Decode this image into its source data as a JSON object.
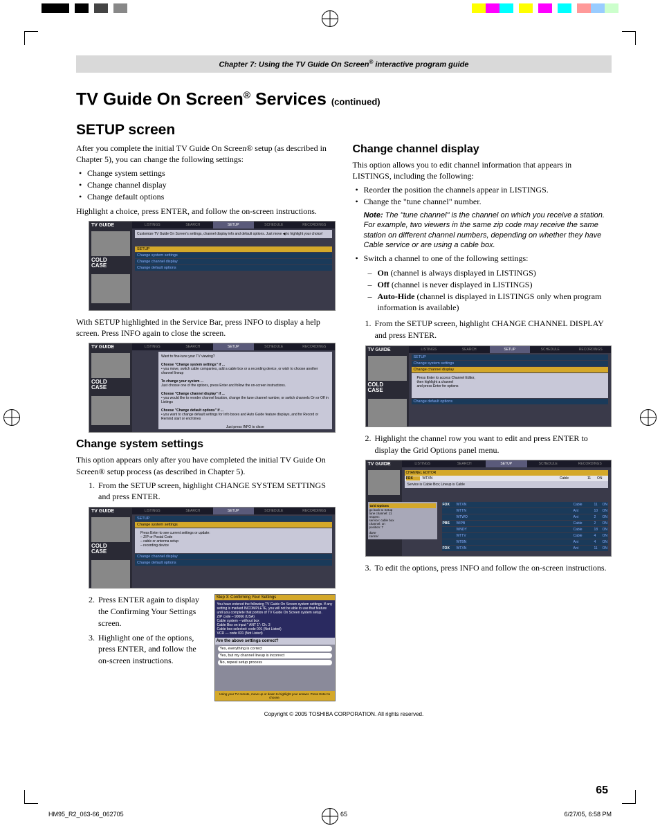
{
  "header": {
    "chapter_label": "Chapter 7: Using the TV Guide On Screen",
    "reg": "®",
    "chapter_suffix": " interactive program guide"
  },
  "title": {
    "main": "TV Guide On Screen",
    "reg": "®",
    "svc": " Services ",
    "cont": "(continued)"
  },
  "setup": {
    "heading": "SETUP screen",
    "intro": "After you complete the initial TV Guide On Screen® setup (as described in Chapter 5), you can change the following settings:",
    "bullets": [
      "Change system settings",
      "Change channel display",
      "Change default options"
    ],
    "instr": "Highlight a choice, press ENTER, and follow the on-screen instructions.",
    "after": "With SETUP highlighted in the Service Bar, press INFO to display a help screen. Press INFO again to close the screen."
  },
  "css": {
    "heading": "Change system settings",
    "intro": "This option appears only after you have completed the initial TV Guide On Screen® setup process (as described in Chapter 5).",
    "step1": "From the SETUP screen, highlight CHANGE SYSTEM SETTINGS and press ENTER.",
    "step2": "Press ENTER again to display the Confirming Your Settings screen.",
    "step3": "Highlight one of the options, press ENTER, and follow the on-screen instructions."
  },
  "ccd": {
    "heading": "Change channel display",
    "intro": "This option allows you to edit channel information that appears in LISTINGS, including the following:",
    "b1": "Reorder the position the channels appear in LISTINGS.",
    "b2": "Change the \"tune channel\" number.",
    "note_label": "Note:",
    "note": " The \"tune channel\" is the channel on which you receive a station. For example, two viewers in the same zip code may receive the same station on different channel numbers, depending on whether they have Cable service or are using a cable box.",
    "b3": "Switch a channel to one of the following settings:",
    "d1_b": "On",
    "d1": " (channel is always displayed in LISTINGS)",
    "d2_b": "Off",
    "d2": " (channel is never displayed in LISTINGS)",
    "d3_b": "Auto-Hide",
    "d3": " (channel is displayed in LISTINGS only when program information is available)",
    "step1": "From the SETUP screen, highlight CHANGE CHANNEL DISPLAY and press ENTER.",
    "step2": "Highlight the channel row you want to edit and press ENTER to display the Grid Options panel menu.",
    "step3": "To edit the options, press INFO and follow the on-screen instructions."
  },
  "ss": {
    "topbar": [
      "LISTINGS",
      "SEARCH",
      "SETUP",
      "SCHEDULE",
      "RECORDINGS"
    ],
    "logo": "TV GUIDE",
    "cold": "COLD\nCASE",
    "tip": "Customize TV Guide On Screen's settings, channel display info and default options. Just move ◀ to highlight your choice!",
    "menu": [
      "SETUP",
      "Change system settings",
      "Change channel display",
      "Change default options"
    ],
    "info_title": "Want to fine-tune your TV viewing?",
    "info_1": "Choose \"Change system settings\" if ...",
    "info_1a": "• you move, switch cable companies, add a cable box or a recording device, or wish to choose another channel lineup",
    "info_2": "To change your system ...",
    "info_2a": "Just choose one of the options, press Enter and follow the on-screen instructions.",
    "info_3": "Choose \"Change channel display\" if ...",
    "info_3a": "• you would like to reorder channel location, change the tune channel number, or switch channels On or Off in Listings",
    "info_4": "Choose \"Change default options\" if ...",
    "info_4a": "• you want to change default settings for Info boxes and Auto Guide feature displays, and for Record or Remind start or end times",
    "info_close": "Just press INFO to close",
    "setup_heading": "SETUP",
    "css_item": "Change system settings",
    "css_detail": "Press Enter to see current settings or update:\n– ZIP or Postal Code\n– cable or antenna setup\n– recording device",
    "ccd_item": "Change channel display",
    "cdo_item": "Change default options",
    "ccd_detail": "Press Enter to access Channel Editor,\nthen highlight a channel\nand press Enter for options",
    "confirm_title": "Step 3: Confirming Your Settings",
    "confirm_body": "You have entered the following TV Guide On Screen system settings. If any setting is marked INCOMPLETE, you will not be able to use that feature until you complete that portion of TV Guide On Screen system setup.\n   ZIP code – 90066 (USA)\n   Cable system – without box\n   Cable Box on input \" ANT 1\": Ch. 3\n   Cable box selected: code 001 (Not Listed)\n   VCR — code 031 (Not Listed)",
    "confirm_prompt": "Are the above settings correct?",
    "confirm_c1": "Yes, everything is correct",
    "confirm_c2": "Yes, but my channel lineup is incorrect",
    "confirm_c3": "No, repeat setup process",
    "confirm_footer": "Using your TV remote, move up or down to highlight your answer. Press Enter to choose.",
    "editor_title": "CHANNEL EDITOR",
    "editor_service": "Service is Cable Box; Lineup is Cable",
    "grid_opt": "Grid Options",
    "go_back": "go back to Setup",
    "rows": [
      {
        "call": "FOX",
        "st": "WTXN",
        "svc": "Cable",
        "ch": "11",
        "on": "ON"
      },
      {
        "call": "",
        "st": "WTTN",
        "svc": "Ant",
        "ch": "10",
        "on": "ON"
      },
      {
        "call": "",
        "st": "WTWO",
        "svc": "Ant",
        "ch": "2",
        "on": "ON"
      },
      {
        "call": "PBS",
        "st": "WIPB",
        "svc": "Cable",
        "ch": "2",
        "on": "ON"
      },
      {
        "call": "",
        "st": "WNDY",
        "svc": "Cable",
        "ch": "18",
        "on": "ON"
      },
      {
        "call": "",
        "st": "WTTV",
        "svc": "Cable",
        "ch": "4",
        "on": "ON"
      },
      {
        "call": "",
        "st": "WTBN",
        "svc": "Ant",
        "ch": "4",
        "on": "ON"
      },
      {
        "call": "FOX",
        "st": "WTXN",
        "svc": "Ant",
        "ch": "11",
        "on": "ON"
      }
    ]
  },
  "copyright": "Copyright © 2005 TOSHIBA CORPORATION. All rights reserved.",
  "page_num": "65",
  "footer": {
    "file": "HM95_R2_063-66_062705",
    "pg": "65",
    "date": "6/27/05, 6:58 PM"
  }
}
